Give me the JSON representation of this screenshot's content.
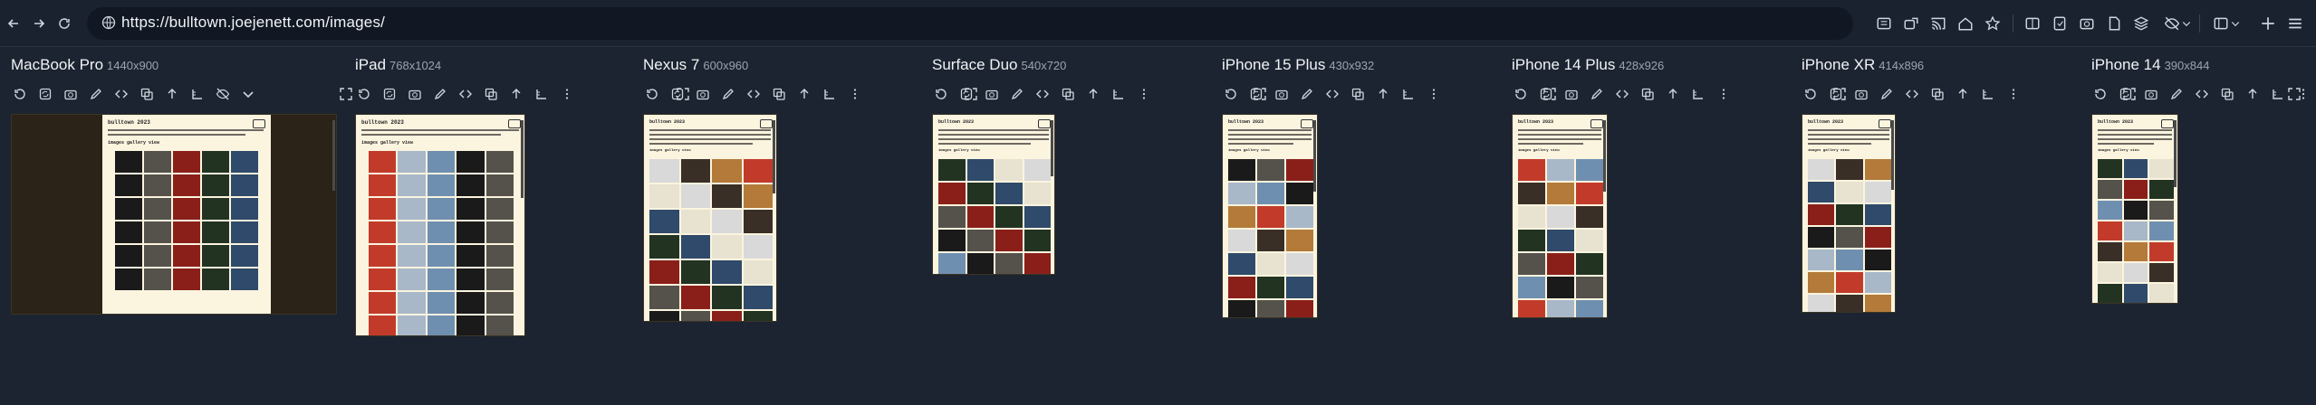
{
  "browser": {
    "url": "https://bulltown.joejenett.com/images/",
    "nav": {
      "back": "back-icon",
      "forward": "forward-icon",
      "reload": "reload-icon"
    },
    "extensions": [
      "reader-icon",
      "share-icon",
      "cast-icon",
      "home-icon",
      "star-icon",
      "split-icon",
      "note-icon",
      "screenshot-icon",
      "page-icon",
      "layers-icon",
      "eye-off-icon",
      "sidebar-icon",
      "add-icon",
      "menu-icon"
    ]
  },
  "devices": [
    {
      "name": "MacBook Pro",
      "res": "1440x900"
    },
    {
      "name": "iPad",
      "res": "768x1024"
    },
    {
      "name": "Nexus 7",
      "res": "600x960"
    },
    {
      "name": "Surface Duo",
      "res": "540x720"
    },
    {
      "name": "iPhone 15 Plus",
      "res": "430x932"
    },
    {
      "name": "iPhone 14 Plus",
      "res": "428x926"
    },
    {
      "name": "iPhone XR",
      "res": "414x896"
    },
    {
      "name": "iPhone 14",
      "res": "390x844"
    }
  ],
  "preview_site": {
    "title": "bulltown 2023",
    "gallery_heading": "images gallery view"
  },
  "colors": {
    "background": "#1c2431",
    "page": "#fbf4df",
    "photo_palette": [
      "#1a1a1a",
      "#3a2f26",
      "#8a1f1a",
      "#c23b2a",
      "#2f4a6a",
      "#6f8fb0",
      "#d9d9d9",
      "#55524c",
      "#b37a3a",
      "#223322",
      "#a9b8c9",
      "#e8e2d0"
    ]
  }
}
